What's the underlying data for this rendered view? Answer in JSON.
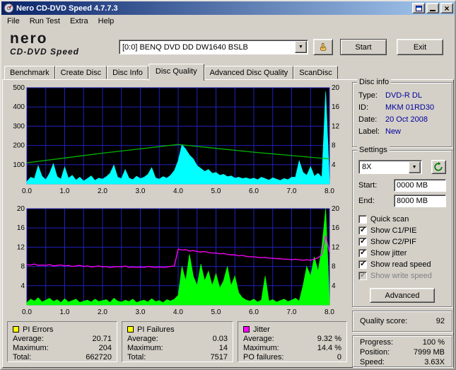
{
  "theme": {
    "titlebar_start": "#0a246a",
    "titlebar_end": "#a6caf0",
    "window_bg": "#d4d0c8",
    "value_text": "#00009c"
  },
  "window": {
    "title": "Nero CD-DVD Speed 4.7.7.3"
  },
  "menu": {
    "items": [
      "File",
      "Run Test",
      "Extra",
      "Help"
    ]
  },
  "header": {
    "logo": {
      "line1": "nero",
      "line2": "CD-DVD Speed"
    },
    "drive_select": {
      "value": "[0:0]  BENQ DVD DD DW1640 BSLB"
    },
    "buttons": {
      "start": "Start",
      "exit": "Exit"
    }
  },
  "tabs": {
    "items": [
      {
        "label": "Benchmark",
        "active": false
      },
      {
        "label": "Create Disc",
        "active": false
      },
      {
        "label": "Disc Info",
        "active": false
      },
      {
        "label": "Disc Quality",
        "active": true
      },
      {
        "label": "Advanced Disc Quality",
        "active": false
      },
      {
        "label": "ScanDisc",
        "active": false
      }
    ]
  },
  "disc_info": {
    "title": "Disc info",
    "rows": [
      {
        "label": "Type:",
        "value": "DVD-R DL"
      },
      {
        "label": "ID:",
        "value": "MKM 01RD30"
      },
      {
        "label": "Date:",
        "value": "20 Oct 2008"
      },
      {
        "label": "Label:",
        "value": "New"
      }
    ]
  },
  "settings": {
    "title": "Settings",
    "speed_select": "8X",
    "start_label": "Start:",
    "start_value": "0000 MB",
    "end_label": "End:",
    "end_value": "8000 MB",
    "checkboxes": [
      {
        "label": "Quick scan",
        "checked": false,
        "enabled": true
      },
      {
        "label": "Show C1/PIE",
        "checked": true,
        "enabled": true
      },
      {
        "label": "Show C2/PIF",
        "checked": true,
        "enabled": true
      },
      {
        "label": "Show jitter",
        "checked": true,
        "enabled": true
      },
      {
        "label": "Show read speed",
        "checked": true,
        "enabled": true
      },
      {
        "label": "Show write speed",
        "checked": true,
        "enabled": false
      }
    ],
    "advanced_button": "Advanced"
  },
  "quality_score": {
    "label": "Quality score:",
    "value": "92"
  },
  "progress": {
    "rows": [
      {
        "label": "Progress:",
        "value": "100 %"
      },
      {
        "label": "Position:",
        "value": "7999 MB"
      },
      {
        "label": "Speed:",
        "value": "3.63X"
      }
    ]
  },
  "stats_panels": [
    {
      "name": "PI Errors",
      "color": "#ffff00",
      "rows": [
        {
          "label": "Average:",
          "value": "20.71"
        },
        {
          "label": "Maximum:",
          "value": "204"
        },
        {
          "label": "Total:",
          "value": "662720"
        }
      ]
    },
    {
      "name": "PI Failures",
      "color": "#ffff00",
      "rows": [
        {
          "label": "Average:",
          "value": "0.03"
        },
        {
          "label": "Maximum:",
          "value": "14"
        },
        {
          "label": "Total:",
          "value": "7517"
        }
      ]
    },
    {
      "name": "Jitter",
      "color": "#ff00ff",
      "rows": [
        {
          "label": "Average:",
          "value": "9.32 %"
        },
        {
          "label": "Maximum:",
          "value": "14.4 %"
        },
        {
          "label": "PO failures:",
          "value": "0"
        }
      ]
    }
  ],
  "chart_data": [
    {
      "type": "area",
      "name": "PI Errors with read speed overlay",
      "bg_color": "#000000",
      "grid_color": "#2121bd",
      "x_range": [
        0,
        8
      ],
      "x_grid_step": 0.5,
      "x_ticks": [
        0,
        1,
        2,
        3,
        4,
        5,
        6,
        7,
        8
      ],
      "x_tick_labels": [
        "0.0",
        "1.0",
        "2.0",
        "3.0",
        "4.0",
        "5.0",
        "6.0",
        "7.0",
        "8.0"
      ],
      "left_axis": {
        "range": [
          0,
          500
        ],
        "ticks": [
          100,
          200,
          300,
          400,
          500
        ]
      },
      "right_axis": {
        "range": [
          0,
          20
        ],
        "ticks": [
          4,
          8,
          12,
          16,
          20
        ]
      },
      "series": [
        {
          "name": "PI Errors",
          "type": "area",
          "axis": "left",
          "color": "#00ffff",
          "x_step": 0.1,
          "values": [
            12,
            35,
            28,
            95,
            40,
            22,
            55,
            105,
            38,
            25,
            88,
            30,
            45,
            20,
            35,
            15,
            28,
            42,
            18,
            30,
            25,
            38,
            55,
            98,
            35,
            28,
            75,
            30,
            22,
            40,
            28,
            35,
            50,
            85,
            32,
            25,
            38,
            30,
            45,
            70,
            120,
            204,
            180,
            150,
            130,
            95,
            80,
            65,
            75,
            55,
            60,
            45,
            50,
            38,
            42,
            30,
            35,
            28,
            32,
            25,
            30,
            22,
            35,
            28,
            20,
            32,
            25,
            18,
            28,
            22,
            35,
            35,
            120,
            60,
            45,
            90,
            40,
            55,
            35,
            480,
            15
          ]
        },
        {
          "name": "Read speed",
          "type": "line",
          "axis": "right",
          "color": "#00b400",
          "points": [
            [
              0,
              4.4
            ],
            [
              1,
              5.4
            ],
            [
              2,
              6.4
            ],
            [
              3,
              7.3
            ],
            [
              4,
              8.2
            ],
            [
              5,
              7.4
            ],
            [
              6,
              6.6
            ],
            [
              7,
              5.9
            ],
            [
              8,
              5.2
            ]
          ]
        }
      ]
    },
    {
      "type": "area",
      "name": "PI Failures with jitter overlay",
      "bg_color": "#000000",
      "grid_color": "#2121bd",
      "x_range": [
        0,
        8
      ],
      "x_grid_step": 0.5,
      "x_ticks": [
        0,
        1,
        2,
        3,
        4,
        5,
        6,
        7,
        8
      ],
      "x_tick_labels": [
        "0.0",
        "1.0",
        "2.0",
        "3.0",
        "4.0",
        "5.0",
        "6.0",
        "7.0",
        "8.0"
      ],
      "left_axis": {
        "range": [
          0,
          20
        ],
        "ticks": [
          4,
          8,
          12,
          16,
          20
        ]
      },
      "right_axis": {
        "range": [
          0,
          20
        ],
        "ticks": [
          4,
          8,
          12,
          16,
          20
        ]
      },
      "series": [
        {
          "name": "PI Failures",
          "type": "area",
          "axis": "left",
          "color": "#00ff00",
          "x_step": 0.1,
          "values": [
            0.5,
            1.2,
            0.8,
            1.5,
            0.6,
            1,
            1.4,
            0.7,
            1.1,
            0.5,
            1.3,
            0.6,
            0.9,
            1.2,
            0.5,
            0.8,
            1,
            0.6,
            1.2,
            0.7,
            0.9,
            1.1,
            0.5,
            1.4,
            0.8,
            0.6,
            1,
            0.7,
            1.2,
            0.5,
            0.8,
            1,
            0.6,
            1.3,
            0.7,
            0.9,
            0.5,
            1.1,
            0.8,
            1.2,
            2,
            8,
            5,
            10.5,
            6,
            4,
            8.5,
            5,
            7,
            4,
            6.5,
            3.5,
            5,
            8,
            4,
            6,
            2.5,
            1.5,
            1,
            0.8,
            1.2,
            0.6,
            1,
            6,
            0.8,
            1.1,
            0.6,
            0.9,
            1.2,
            0.7,
            1,
            1.4,
            0.8,
            4,
            8,
            6,
            10,
            7,
            12,
            20,
            1
          ]
        },
        {
          "name": "Jitter",
          "type": "line",
          "axis": "left",
          "color": "#ff00ff",
          "x_step": 0.1,
          "values": [
            8.4,
            8.3,
            8.5,
            8.2,
            8.3,
            8.2,
            8.4,
            8.1,
            8.2,
            8.3,
            8.1,
            8.2,
            8,
            8.1,
            8.2,
            8,
            8.1,
            7.9,
            8,
            8.1,
            7.9,
            8,
            7.8,
            7.9,
            8,
            7.9,
            8.1,
            7.8,
            7.9,
            7.8,
            7.9,
            7.8,
            8,
            7.9,
            7.8,
            7.9,
            7.8,
            7.9,
            8,
            8.1,
            11.6,
            11.4,
            11.5,
            11.2,
            11.3,
            11.1,
            11,
            11.1,
            10.9,
            10.8,
            10.8,
            10.6,
            10.7,
            10.5,
            10.4,
            10.4,
            10.2,
            10.3,
            10.1,
            10,
            10,
            9.9,
            9.8,
            9.9,
            9.7,
            9.7,
            9.6,
            9.6,
            9.5,
            9.5,
            9.4,
            9.5,
            9.4,
            9.3,
            9.4,
            9.3,
            9.5,
            9.8,
            10.5,
            14.4,
            11
          ]
        }
      ]
    }
  ]
}
